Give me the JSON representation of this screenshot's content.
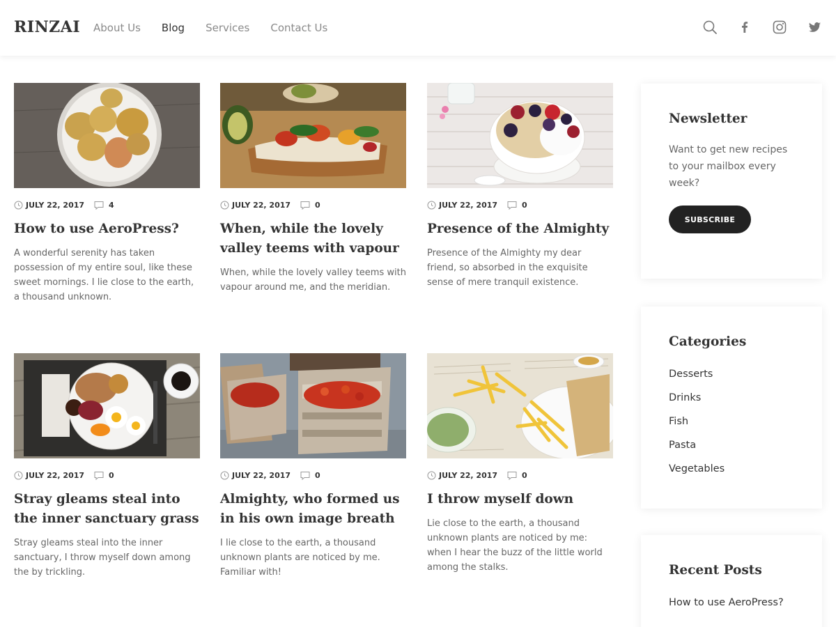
{
  "header": {
    "logo": "RINZAI",
    "nav": [
      {
        "label": "About Us",
        "active": false
      },
      {
        "label": "Blog",
        "active": true
      },
      {
        "label": "Services",
        "active": false
      },
      {
        "label": "Contact Us",
        "active": false
      }
    ],
    "icons": [
      "search-icon",
      "facebook-icon",
      "instagram-icon",
      "twitter-icon"
    ]
  },
  "posts": [
    {
      "date": "JULY 22, 2017",
      "comments": "4",
      "title": "How to use AeroPress?",
      "excerpt": "A wonderful serenity has taken possession of my entire soul, like these sweet mornings. I lie close to the earth, a thousand unknown.",
      "image": "bowl-of-pears"
    },
    {
      "date": "JULY 22, 2017",
      "comments": "0",
      "title": "When, while the lovely valley teems with vapour",
      "excerpt": "When, while the lovely valley teems with vapour around me, and the meridian.",
      "image": "bruschetta-with-avocado"
    },
    {
      "date": "JULY 22, 2017",
      "comments": "0",
      "title": "Presence of the Almighty",
      "excerpt": "Presence of the Almighty my dear friend, so absorbed in the exquisite sense of mere tranquil existence.",
      "image": "granola-bowl-with-berries"
    },
    {
      "date": "JULY 22, 2017",
      "comments": "0",
      "title": "Stray gleams steal into the inner sanctuary grass",
      "excerpt": "Stray gleams steal into the inner sanctuary, I throw myself down among the by trickling.",
      "image": "breakfast-plate-with-coffee"
    },
    {
      "date": "JULY 22, 2017",
      "comments": "0",
      "title": "Almighty, who formed us in his own image breath",
      "excerpt": "I lie close to the earth, a thousand unknown plants are noticed by me. Familiar with!",
      "image": "crates-of-tomatoes"
    },
    {
      "date": "JULY 22, 2017",
      "comments": "0",
      "title": "I throw myself down",
      "excerpt": "Lie close to the earth, a thousand unknown plants are noticed by me: when I hear the buzz of the little world among the stalks.",
      "image": "french-fries-on-newspaper"
    }
  ],
  "sidebar": {
    "newsletter": {
      "title": "Newsletter",
      "text": "Want to get new recipes to your mailbox every week?",
      "button": "SUBSCRIBE"
    },
    "categories": {
      "title": "Categories",
      "items": [
        "Desserts",
        "Drinks",
        "Fish",
        "Pasta",
        "Vegetables"
      ]
    },
    "recent_posts": {
      "title": "Recent Posts",
      "items": [
        "How to use AeroPress?"
      ]
    }
  },
  "colors": {
    "text": "#333333",
    "muted": "#666666",
    "nav_inactive": "#8a8a8a",
    "button_bg": "#222222"
  }
}
